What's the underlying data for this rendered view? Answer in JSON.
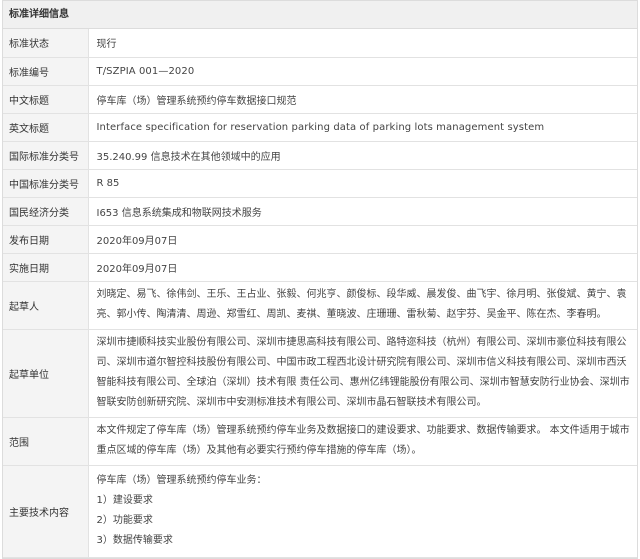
{
  "header": {
    "title": "标准详细信息"
  },
  "rows": {
    "status": {
      "label": "标准状态",
      "value": "现行"
    },
    "number": {
      "label": "标准编号",
      "value": "T/SZPIA 001—2020"
    },
    "cn_title": {
      "label": "中文标题",
      "value": "停车库（场）管理系统预约停车数据接口规范"
    },
    "en_title": {
      "label": "英文标题",
      "value": "Interface specification for reservation parking data of parking lots management system"
    },
    "intl_class": {
      "label": "国际标准分类号",
      "value": "35.240.99 信息技术在其他领域中的应用"
    },
    "cn_class": {
      "label": "中国标准分类号",
      "value": "R 85"
    },
    "economy": {
      "label": "国民经济分类",
      "value": "I653 信息系统集成和物联网技术服务"
    },
    "publish": {
      "label": "发布日期",
      "value": "2020年09月07日"
    },
    "implement": {
      "label": "实施日期",
      "value": "2020年09月07日"
    },
    "drafters": {
      "label": "起草人",
      "value": "刘晓定、易飞、徐伟剑、王乐、王占业、张毅、何兆亨、颜俊标、段华威、晨发俊、曲飞宇、徐月明、张俊斌、黄宁、袁亮、郭小传、陶清清、周逊、郑雪红、周凯、麦祺、董晓波、庄珊珊、雷秋菊、赵宇芬、吴金平、陈在杰、李春明。"
    },
    "drafting_units": {
      "label": "起草单位",
      "value": "深圳市捷顺科技实业股份有限公司、深圳市捷思高科技有限公司、路特迩科技（杭州）有限公司、深圳市豪位科技有限公司、深圳市道尔智控科技股份有限公司、中国市政工程西北设计研究院有限公司、深圳市信义科技有限公司、深圳市西沃智能科技有限公司、全球泊（深圳）技术有限 责任公司、惠州亿纬锂能股份有限公司、深圳市智慧安防行业协会、深圳市智联安防创新研究院、深圳市中安测标准技术有限公司、深圳市晶石智联技术有限公司。"
    },
    "scope": {
      "label": "范围",
      "value": "本文件规定了停车库（场）管理系统预约停车业务及数据接口的建设要求、功能要求、数据传输要求。 本文件适用于城市重点区域的停车库（场）及其他有必要实行预约停车措施的停车库（场）。"
    },
    "tech": {
      "label": "主要技术内容",
      "lines": [
        "停车库（场）管理系统预约停车业务：",
        "1）建设要求",
        "2）功能要求",
        "3）数据传输要求"
      ]
    }
  }
}
